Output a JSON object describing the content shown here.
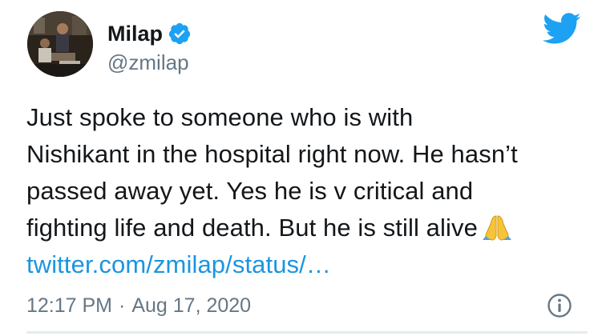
{
  "author": {
    "display_name": "Milap",
    "handle": "@zmilap",
    "verified_icon": "verified-badge-icon",
    "avatar_icon": "profile-avatar"
  },
  "brand": {
    "logo_icon": "twitter-bird-icon",
    "accent_color": "#1da1f2",
    "link_color": "#1b95e0",
    "muted_color": "#657786",
    "text_color": "#14171a"
  },
  "tweet": {
    "lines": [
      "Just spoke to someone who is with",
      "Nishikant in the hospital right now. He hasn’t",
      "passed away yet. Yes he is v critical and",
      "fighting life and death. But he is still alive"
    ],
    "emoji_icon": "folded-hands-icon",
    "link_text": "twitter.com/zmilap/status/…"
  },
  "meta": {
    "time": "12:17 PM",
    "separator": "·",
    "date": "Aug 17, 2020",
    "info_icon": "info-icon"
  }
}
